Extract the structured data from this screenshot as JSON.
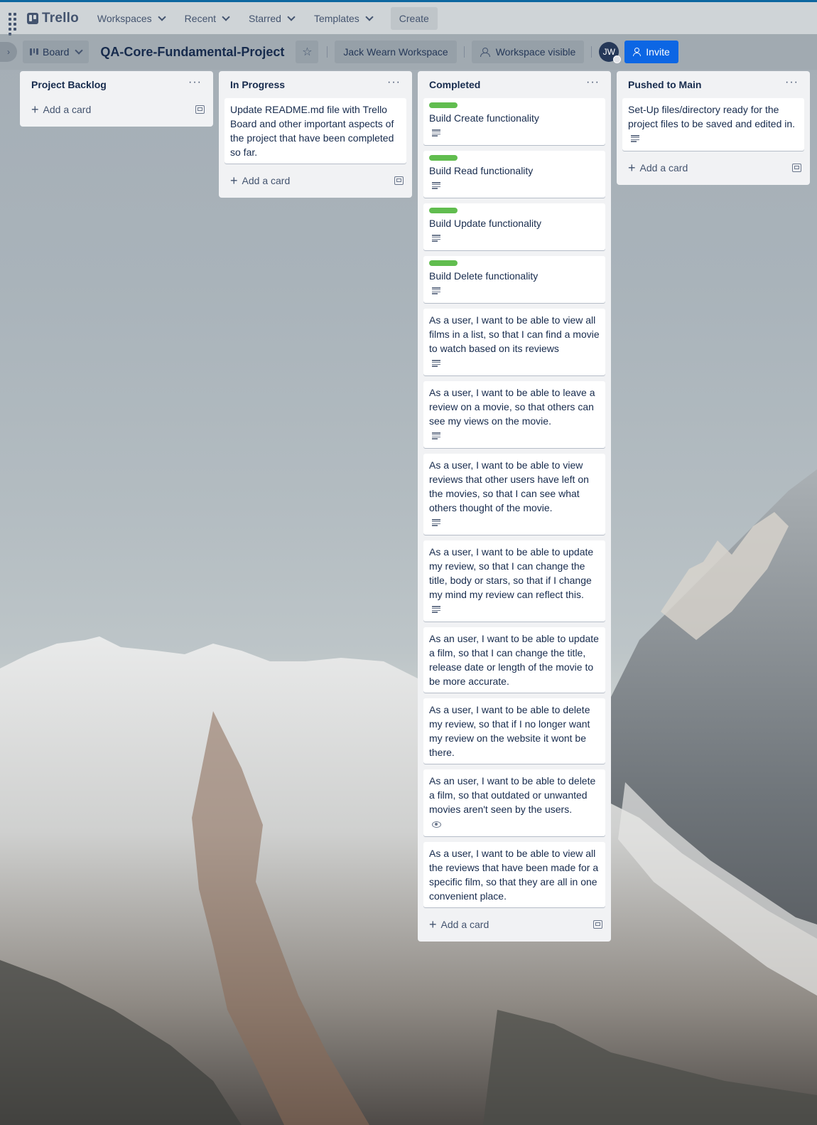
{
  "topbar": {
    "logo": "Trello",
    "nav": [
      "Workspaces",
      "Recent",
      "Starred",
      "Templates"
    ],
    "create": "Create"
  },
  "board": {
    "view": "Board",
    "title": "QA-Core-Fundamental-Project",
    "workspace": "Jack Wearn Workspace",
    "visibility": "Workspace visible",
    "avatar_initials": "JW",
    "invite": "Invite",
    "accent": "#0c66e4",
    "label_color": "#61bd4f"
  },
  "lists": [
    {
      "title": "Project Backlog",
      "cards": [],
      "add_card": "Add a card"
    },
    {
      "title": "In Progress",
      "cards": [
        {
          "text": "Update README.md file with Trello Board and other important aspects of the project that have been completed so far.",
          "label": false,
          "badge": ""
        }
      ],
      "add_card": "Add a card"
    },
    {
      "title": "Completed",
      "cards": [
        {
          "text": "Build Create functionality",
          "label": true,
          "badge": "description-icon"
        },
        {
          "text": "Build Read functionality",
          "label": true,
          "badge": "description-icon"
        },
        {
          "text": "Build Update functionality",
          "label": true,
          "badge": "description-icon"
        },
        {
          "text": "Build Delete functionality",
          "label": true,
          "badge": "description-icon"
        },
        {
          "text": "As a user, I want to be able to view all films in a list, so that I can find a movie to watch based on its reviews",
          "label": false,
          "badge": "description-icon"
        },
        {
          "text": "As a user, I want to be able to leave a review on a movie, so that others can see my views on the movie.",
          "label": false,
          "badge": "description-icon"
        },
        {
          "text": "As a user, I want to be able to view reviews that other users have left on the movies, so that I can see what others thought of the movie.",
          "label": false,
          "badge": "description-icon"
        },
        {
          "text": "As a user, I want to be able to update my review, so that I can change the title, body or stars, so that if I change my mind my review can reflect this.",
          "label": false,
          "badge": "description-icon"
        },
        {
          "text": "As an user, I want to be able to update a film, so that I can change the title, release date or length of the movie to be more accurate.",
          "label": false,
          "badge": ""
        },
        {
          "text": "As a user, I want to be able to delete my review, so that if I no longer want my review on the website it wont be there.",
          "label": false,
          "badge": ""
        },
        {
          "text": "As an user, I want to be able to delete a film, so that outdated or unwanted movies aren't seen by the users.",
          "label": false,
          "badge": "watch-icon"
        },
        {
          "text": "As a user, I want to be able to view all the reviews that have been made for a specific film, so that they are all in one convenient place.",
          "label": false,
          "badge": ""
        }
      ],
      "add_card": "Add a card"
    },
    {
      "title": "Pushed to Main",
      "cards": [
        {
          "text": "Set-Up files/directory ready for the project files to be saved and edited in.",
          "label": false,
          "badge": "description-icon"
        }
      ],
      "add_card": "Add a card"
    }
  ]
}
